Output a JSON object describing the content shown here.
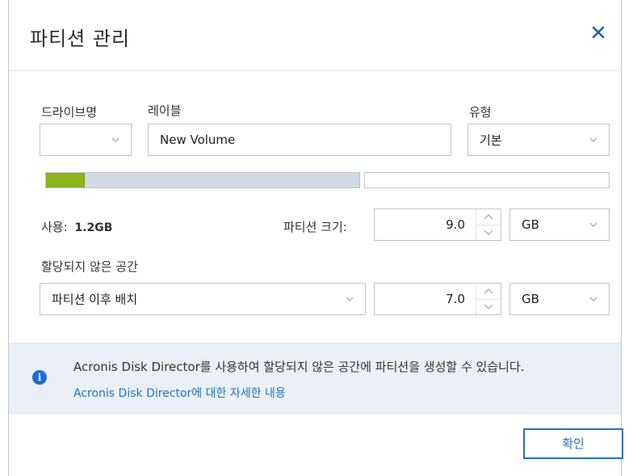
{
  "dialog": {
    "title": "파티션 관리",
    "close_icon": "close-icon"
  },
  "drive": {
    "label": "드라이브명",
    "value": ""
  },
  "volume_label": {
    "label": "레이블",
    "value": "New Volume"
  },
  "type": {
    "label": "유형",
    "value": "기본"
  },
  "usage_bar": {
    "used_fraction": 0.12,
    "used_color": "#8ab51c",
    "bar_color": "#d0dae3"
  },
  "used": {
    "label": "사용:",
    "value": "1.2GB"
  },
  "partition_size": {
    "label": "파티션 크기:",
    "value": "9.0",
    "unit": "GB"
  },
  "unallocated": {
    "label": "할당되지 않은 공간",
    "placement": "파티션 이후 배치",
    "value": "7.0",
    "unit": "GB"
  },
  "info": {
    "text": "Acronis Disk Director를 사용하여 할당되지 않은 공간에 파티션을 생성할 수 있습니다.",
    "link": "Acronis Disk Director에 대한 자세한 내용",
    "icon": "info-icon",
    "icon_color": "#1e6bd6"
  },
  "buttons": {
    "ok": "확인"
  }
}
